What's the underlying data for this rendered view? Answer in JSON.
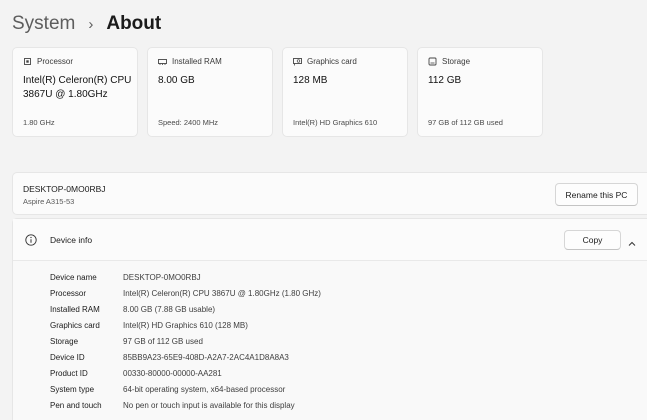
{
  "breadcrumb": {
    "parent": "System",
    "separator": "›",
    "current": "About"
  },
  "cards": [
    {
      "icon": "processor-icon",
      "title": "Processor",
      "value": "Intel(R) Celeron(R) CPU 3867U @ 1.80GHz",
      "sub": "1.80 GHz"
    },
    {
      "icon": "ram-icon",
      "title": "Installed RAM",
      "value": "8.00 GB",
      "sub": "Speed: 2400 MHz"
    },
    {
      "icon": "graphics-card-icon",
      "title": "Graphics card",
      "value": "128 MB",
      "sub": "Intel(R) HD Graphics 610"
    },
    {
      "icon": "storage-icon",
      "title": "Storage",
      "value": "112 GB",
      "sub": "97 GB of 112 GB used"
    }
  ],
  "pc": {
    "name": "DESKTOP-0MO0RBJ",
    "model": "Aspire A315-53",
    "rename_label": "Rename this PC"
  },
  "device_info": {
    "title": "Device info",
    "copy_label": "Copy",
    "specs": [
      {
        "label": "Device name",
        "value": "DESKTOP-0MO0RBJ"
      },
      {
        "label": "Processor",
        "value": "Intel(R) Celeron(R) CPU 3867U @ 1.80GHz (1.80 GHz)"
      },
      {
        "label": "Installed RAM",
        "value": "8.00 GB (7.88 GB usable)"
      },
      {
        "label": "Graphics card",
        "value": "Intel(R) HD Graphics 610 (128 MB)"
      },
      {
        "label": "Storage",
        "value": "97 GB of 112 GB used"
      },
      {
        "label": "Device ID",
        "value": "85BB9A23-65E9-408D-A2A7-2AC4A1D8A8A3"
      },
      {
        "label": "Product ID",
        "value": "00330-80000-00000-AA281"
      },
      {
        "label": "System type",
        "value": "64-bit operating system, x64-based processor"
      },
      {
        "label": "Pen and touch",
        "value": "No pen or touch input is available for this display"
      }
    ]
  }
}
